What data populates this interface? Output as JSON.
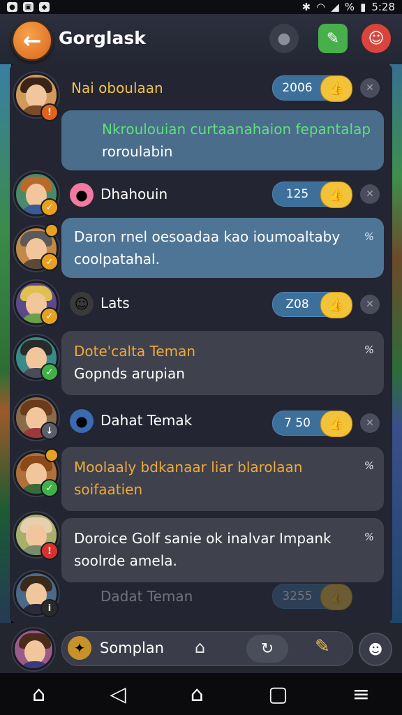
{
  "status": {
    "pct": "%",
    "time": "5:28"
  },
  "header": {
    "title": "Gorglask",
    "back_icon": "arrow-left-icon"
  },
  "items": [
    {
      "name": "Nai oboulaan",
      "value": "2006",
      "bubble1": "Nkroulouian curtaanahaion fepantalap",
      "bubble2": "roroulabin",
      "pct": ""
    },
    {
      "name": "Dhahouin",
      "value": "125",
      "bubble1": "Daron rnel oesoadaa kao ioumoaltaby",
      "bubble2": "coolpatahal.",
      "pct": "%"
    },
    {
      "name": "Lats",
      "value": "Z08",
      "bubble1": "Dote'calta Teman",
      "bubble2": "Gopnds arupian",
      "pct": "%"
    },
    {
      "name": "Dahat Temak",
      "value": "7 50",
      "bubble1": "Moolaaly bdkanaar liar blarolaan",
      "bubble2": "soifaatien",
      "pct": "%"
    },
    {
      "name": "",
      "value": "",
      "bubble1": "Doroice Golf sanie ok inalvar Impank",
      "bubble2": "soolrde amela.",
      "pct": "%"
    },
    {
      "name": "Dadat Teman",
      "value": "3255"
    }
  ],
  "composer": {
    "label": "Somplan"
  },
  "colors": {
    "accent": "#e9a43a",
    "green_text": "#5fe07a",
    "blue_bubble": "#4a6d8c"
  }
}
